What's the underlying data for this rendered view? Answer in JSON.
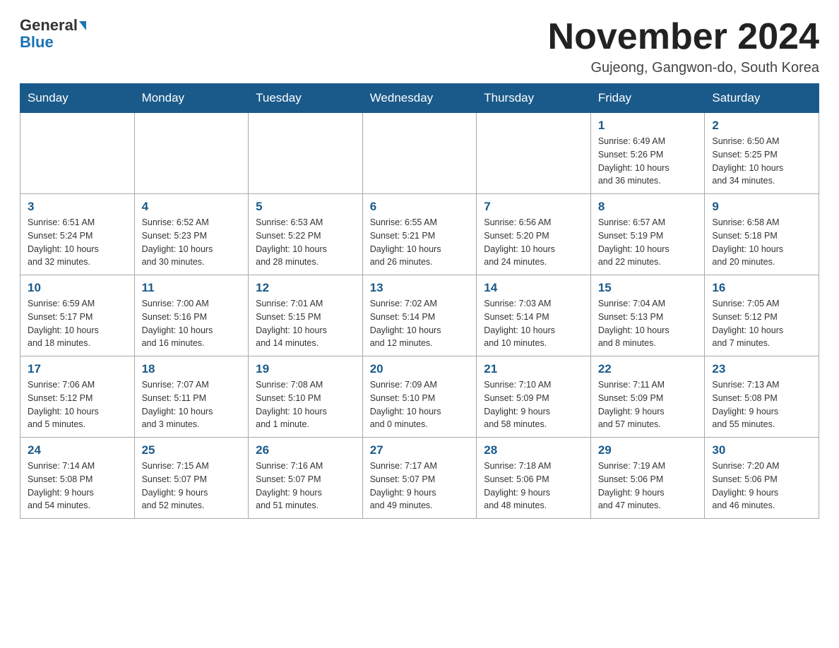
{
  "header": {
    "logo_general": "General",
    "logo_blue": "Blue",
    "title": "November 2024",
    "subtitle": "Gujeong, Gangwon-do, South Korea"
  },
  "weekdays": [
    "Sunday",
    "Monday",
    "Tuesday",
    "Wednesday",
    "Thursday",
    "Friday",
    "Saturday"
  ],
  "weeks": [
    [
      {
        "day": "",
        "info": ""
      },
      {
        "day": "",
        "info": ""
      },
      {
        "day": "",
        "info": ""
      },
      {
        "day": "",
        "info": ""
      },
      {
        "day": "",
        "info": ""
      },
      {
        "day": "1",
        "info": "Sunrise: 6:49 AM\nSunset: 5:26 PM\nDaylight: 10 hours\nand 36 minutes."
      },
      {
        "day": "2",
        "info": "Sunrise: 6:50 AM\nSunset: 5:25 PM\nDaylight: 10 hours\nand 34 minutes."
      }
    ],
    [
      {
        "day": "3",
        "info": "Sunrise: 6:51 AM\nSunset: 5:24 PM\nDaylight: 10 hours\nand 32 minutes."
      },
      {
        "day": "4",
        "info": "Sunrise: 6:52 AM\nSunset: 5:23 PM\nDaylight: 10 hours\nand 30 minutes."
      },
      {
        "day": "5",
        "info": "Sunrise: 6:53 AM\nSunset: 5:22 PM\nDaylight: 10 hours\nand 28 minutes."
      },
      {
        "day": "6",
        "info": "Sunrise: 6:55 AM\nSunset: 5:21 PM\nDaylight: 10 hours\nand 26 minutes."
      },
      {
        "day": "7",
        "info": "Sunrise: 6:56 AM\nSunset: 5:20 PM\nDaylight: 10 hours\nand 24 minutes."
      },
      {
        "day": "8",
        "info": "Sunrise: 6:57 AM\nSunset: 5:19 PM\nDaylight: 10 hours\nand 22 minutes."
      },
      {
        "day": "9",
        "info": "Sunrise: 6:58 AM\nSunset: 5:18 PM\nDaylight: 10 hours\nand 20 minutes."
      }
    ],
    [
      {
        "day": "10",
        "info": "Sunrise: 6:59 AM\nSunset: 5:17 PM\nDaylight: 10 hours\nand 18 minutes."
      },
      {
        "day": "11",
        "info": "Sunrise: 7:00 AM\nSunset: 5:16 PM\nDaylight: 10 hours\nand 16 minutes."
      },
      {
        "day": "12",
        "info": "Sunrise: 7:01 AM\nSunset: 5:15 PM\nDaylight: 10 hours\nand 14 minutes."
      },
      {
        "day": "13",
        "info": "Sunrise: 7:02 AM\nSunset: 5:14 PM\nDaylight: 10 hours\nand 12 minutes."
      },
      {
        "day": "14",
        "info": "Sunrise: 7:03 AM\nSunset: 5:14 PM\nDaylight: 10 hours\nand 10 minutes."
      },
      {
        "day": "15",
        "info": "Sunrise: 7:04 AM\nSunset: 5:13 PM\nDaylight: 10 hours\nand 8 minutes."
      },
      {
        "day": "16",
        "info": "Sunrise: 7:05 AM\nSunset: 5:12 PM\nDaylight: 10 hours\nand 7 minutes."
      }
    ],
    [
      {
        "day": "17",
        "info": "Sunrise: 7:06 AM\nSunset: 5:12 PM\nDaylight: 10 hours\nand 5 minutes."
      },
      {
        "day": "18",
        "info": "Sunrise: 7:07 AM\nSunset: 5:11 PM\nDaylight: 10 hours\nand 3 minutes."
      },
      {
        "day": "19",
        "info": "Sunrise: 7:08 AM\nSunset: 5:10 PM\nDaylight: 10 hours\nand 1 minute."
      },
      {
        "day": "20",
        "info": "Sunrise: 7:09 AM\nSunset: 5:10 PM\nDaylight: 10 hours\nand 0 minutes."
      },
      {
        "day": "21",
        "info": "Sunrise: 7:10 AM\nSunset: 5:09 PM\nDaylight: 9 hours\nand 58 minutes."
      },
      {
        "day": "22",
        "info": "Sunrise: 7:11 AM\nSunset: 5:09 PM\nDaylight: 9 hours\nand 57 minutes."
      },
      {
        "day": "23",
        "info": "Sunrise: 7:13 AM\nSunset: 5:08 PM\nDaylight: 9 hours\nand 55 minutes."
      }
    ],
    [
      {
        "day": "24",
        "info": "Sunrise: 7:14 AM\nSunset: 5:08 PM\nDaylight: 9 hours\nand 54 minutes."
      },
      {
        "day": "25",
        "info": "Sunrise: 7:15 AM\nSunset: 5:07 PM\nDaylight: 9 hours\nand 52 minutes."
      },
      {
        "day": "26",
        "info": "Sunrise: 7:16 AM\nSunset: 5:07 PM\nDaylight: 9 hours\nand 51 minutes."
      },
      {
        "day": "27",
        "info": "Sunrise: 7:17 AM\nSunset: 5:07 PM\nDaylight: 9 hours\nand 49 minutes."
      },
      {
        "day": "28",
        "info": "Sunrise: 7:18 AM\nSunset: 5:06 PM\nDaylight: 9 hours\nand 48 minutes."
      },
      {
        "day": "29",
        "info": "Sunrise: 7:19 AM\nSunset: 5:06 PM\nDaylight: 9 hours\nand 47 minutes."
      },
      {
        "day": "30",
        "info": "Sunrise: 7:20 AM\nSunset: 5:06 PM\nDaylight: 9 hours\nand 46 minutes."
      }
    ]
  ]
}
